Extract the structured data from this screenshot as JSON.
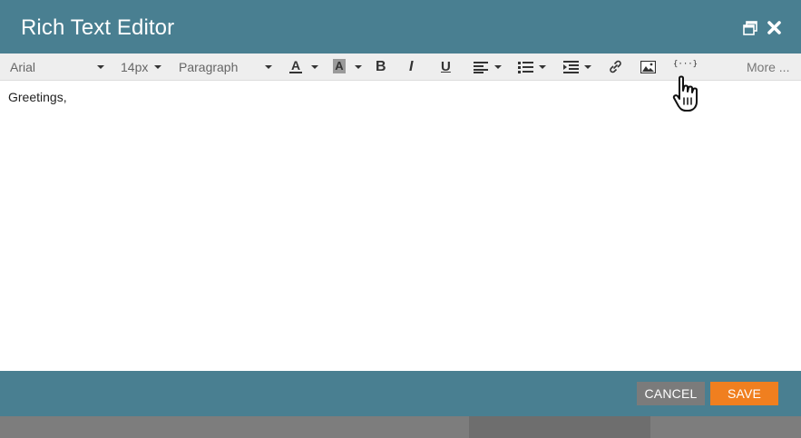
{
  "header": {
    "title": "Rich Text Editor"
  },
  "toolbar": {
    "font_family": "Arial",
    "font_size": "14px",
    "block_format": "Paragraph",
    "text_color_glyph": "A",
    "bg_color_glyph": "A",
    "bold_glyph": "B",
    "italic_glyph": "I",
    "underline_glyph": "U",
    "token_glyph": "{···}",
    "more_label": "More ...",
    "text_color": "#333333",
    "bg_color_swatch": "#9a9a9a"
  },
  "editor": {
    "content": "Greetings,"
  },
  "footer": {
    "cancel_label": "CANCEL",
    "save_label": "SAVE"
  },
  "colors": {
    "header_bg": "#497f91",
    "save": "#f07f1f",
    "cancel": "#7b7b7b"
  }
}
